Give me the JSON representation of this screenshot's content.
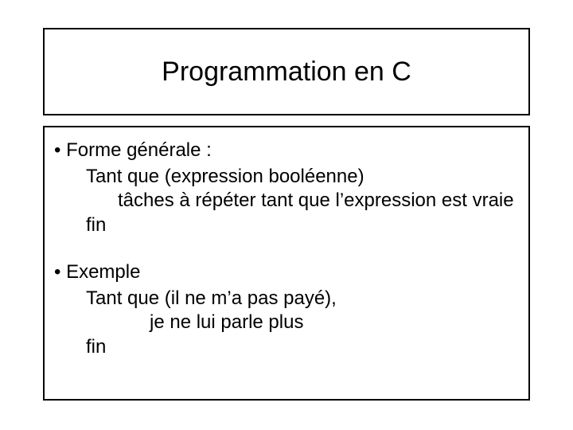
{
  "title": "Programmation en C",
  "section1": {
    "bullet": "• Forme générale :",
    "line1": "Tant que (expression booléenne)",
    "line2": "tâches à répéter tant que l’expression est vraie",
    "line3": "fin"
  },
  "section2": {
    "bullet": "• Exemple",
    "line1": "Tant que (il ne m’a pas payé),",
    "line2": "je ne lui parle plus",
    "line3": "fin"
  }
}
